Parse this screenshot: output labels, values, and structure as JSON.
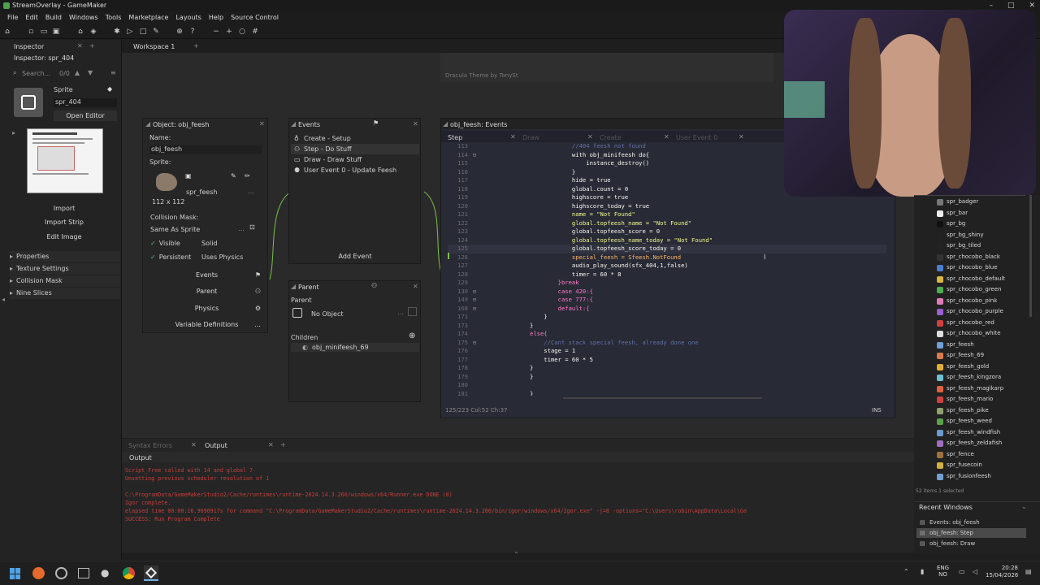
{
  "window": {
    "title": "StreamOverlay - GameMaker",
    "controls": [
      "–",
      "□",
      "✕"
    ]
  },
  "menu": [
    "File",
    "Edit",
    "Build",
    "Windows",
    "Tools",
    "Marketplace",
    "Layouts",
    "Help",
    "Source Control"
  ],
  "inspector": {
    "tab": "Inspector",
    "title": "Inspector: spr_404",
    "search_placeholder": "Search...",
    "counter": "0/0",
    "section": "Sprite",
    "sprite_name": "spr_404",
    "open_editor": "Open Editor",
    "buttons": [
      "Import",
      "Import Strip",
      "Edit Image"
    ],
    "sections": [
      "Properties",
      "Texture Settings",
      "Collision Mask",
      "Nine Slices"
    ]
  },
  "workspace": {
    "tab": "Workspace 1",
    "theme_note": "Dracula Theme by TonySt"
  },
  "object": {
    "title": "Object: obj_feesh",
    "name_label": "Name:",
    "name": "obj_feesh",
    "sprite_label": "Sprite:",
    "sprite": "spr_feesh",
    "sprite_size": "112 x 112",
    "collision_label": "Collision Mask:",
    "collision_value": "Same As Sprite",
    "visible": "Visible",
    "solid": "Solid",
    "persistent": "Persistent",
    "uses_physics": "Uses Physics",
    "buttons": [
      "Events",
      "Parent",
      "Physics",
      "Variable Definitions"
    ]
  },
  "events": {
    "title": "Events",
    "items": [
      "Create - Setup",
      "Step - Do Stuff",
      "Draw - Draw Stuff",
      "User Event 0 - Update Feesh"
    ],
    "add": "Add Event"
  },
  "parent": {
    "title": "Parent",
    "label": "Parent",
    "value": "No Object",
    "children_label": "Children",
    "child": "obj_minifeesh_69"
  },
  "editor": {
    "title": "obj_feesh: Events",
    "tabs": [
      "Step",
      "Draw",
      "Create",
      "User Event 0"
    ],
    "status": "125/223 Col:52 Ch:37",
    "mode": "INS",
    "lines": [
      {
        "n": "113",
        "t": "            //404 feesh not found",
        "c": "#6272a4"
      },
      {
        "n": "114",
        "t": "            with obj_minifeesh do{",
        "c": "#f8f8f2"
      },
      {
        "n": "115",
        "t": "                instance_destroy()",
        "c": "#f8f8f2"
      },
      {
        "n": "116",
        "t": "            }",
        "c": "#f8f8f2"
      },
      {
        "n": "117",
        "t": "            hide = true",
        "c": "#f8f8f2"
      },
      {
        "n": "118",
        "t": "            global.count = 0",
        "c": "#f8f8f2"
      },
      {
        "n": "119",
        "t": "            highscore = true",
        "c": "#f8f8f2"
      },
      {
        "n": "120",
        "t": "            highscore_today = true",
        "c": "#f8f8f2"
      },
      {
        "n": "121",
        "t": "            name = \"Not Found\"",
        "c": "#f1fa8c"
      },
      {
        "n": "122",
        "t": "            global.topfeesh_name = \"Not Found\"",
        "c": "#f1fa8c"
      },
      {
        "n": "123",
        "t": "            global.topfeesh_score = 0",
        "c": "#f8f8f2"
      },
      {
        "n": "124",
        "t": "            global.topfeesh_name_today = \"Not Found\"",
        "c": "#f1fa8c"
      },
      {
        "n": "125",
        "t": "            global.topfeesh_score_today = 0",
        "c": "#f8f8f2"
      },
      {
        "n": "126",
        "t": "            special_feesh = Sfeesh.NotFound",
        "c": "#ffb86c"
      },
      {
        "n": "127",
        "t": "            audio_play_sound(sfx_404,1,false)",
        "c": "#f8f8f2"
      },
      {
        "n": "128",
        "t": "            timer = 60 * 8",
        "c": "#f8f8f2"
      },
      {
        "n": "129",
        "t": "        }break",
        "c": "#ff79c6"
      },
      {
        "n": "130",
        "t": "        case 420:{",
        "c": "#ff79c6"
      },
      {
        "n": "149",
        "t": "        case 777:{",
        "c": "#ff79c6"
      },
      {
        "n": "168",
        "t": "        default:{",
        "c": "#ff79c6"
      },
      {
        "n": "171",
        "t": "    }",
        "c": "#f8f8f2"
      },
      {
        "n": "173",
        "t": "}",
        "c": "#f8f8f2"
      },
      {
        "n": "174",
        "t": "else{",
        "c": "#ff79c6"
      },
      {
        "n": "175",
        "t": "    //Cant stack special feesh, already done one",
        "c": "#6272a4"
      },
      {
        "n": "176",
        "t": "    stage = 1",
        "c": "#f8f8f2"
      },
      {
        "n": "177",
        "t": "    timer = 60 * 5",
        "c": "#f8f8f2"
      },
      {
        "n": "178",
        "t": "}",
        "c": "#f8f8f2"
      },
      {
        "n": "179",
        "t": "}",
        "c": "#f8f8f2"
      },
      {
        "n": "180",
        "t": "",
        "c": "#f8f8f2"
      },
      {
        "n": "181",
        "t": "}",
        "c": "#f8f8f2"
      },
      {
        "n": "182",
        "t": "",
        "c": "#f8f8f2"
      }
    ]
  },
  "output": {
    "tabs": [
      "Syntax Errors",
      "Output"
    ],
    "title": "Output",
    "lines": [
      {
        "t": "Script_Free called with 14 and global 7",
        "c": "#c43e3e"
      },
      {
        "t": "Unsetting previous scheduler resolution of 1",
        "c": "#c43e3e"
      },
      {
        "t": "",
        "c": "#c43e3e"
      },
      {
        "t": "C:\\ProgramData/GameMakerStudio2/Cache/runtimes\\runtime-2024.14.3.260/windows/x64/Runner.exe DONE (0)",
        "c": "#c43e3e"
      },
      {
        "t": "Igor complete.",
        "c": "#c43e3e"
      },
      {
        "t": "elapsed time 00:00:16.9696917s for command \"C:\\ProgramData/GameMakerStudio2/Cache/runtimes\\runtime-2024.14.3.260/bin/igor/windows/x64/Igor.exe\" -j=8 -options=\"C:\\Users\\robin\\AppData\\Local\\Ga",
        "c": "#c43e3e"
      },
      {
        "t": "SUCCESS: Run Program Complete",
        "c": "#c43e3e"
      }
    ]
  },
  "assets": {
    "items": [
      {
        "name": "spr_badger",
        "color": "#777"
      },
      {
        "name": "spr_bar",
        "color": "#eee"
      },
      {
        "name": "spr_bg",
        "color": "#111"
      },
      {
        "name": "spr_bg_shiny",
        "color": "#222"
      },
      {
        "name": "spr_bg_tiled",
        "color": "#222"
      },
      {
        "name": "spr_chocobo_black",
        "color": "#333"
      },
      {
        "name": "spr_chocobo_blue",
        "color": "#4a7fd0"
      },
      {
        "name": "spr_chocobo_default",
        "color": "#d8b642"
      },
      {
        "name": "spr_chocobo_green",
        "color": "#4caf50"
      },
      {
        "name": "spr_chocobo_pink",
        "color": "#e07bb8"
      },
      {
        "name": "spr_chocobo_purple",
        "color": "#9a5fd0"
      },
      {
        "name": "spr_chocobo_red",
        "color": "#d04040"
      },
      {
        "name": "spr_chocobo_white",
        "color": "#ddd"
      },
      {
        "name": "spr_feesh",
        "color": "#6fa0d8"
      },
      {
        "name": "spr_feesh_69",
        "color": "#d87a4a"
      },
      {
        "name": "spr_feesh_gold",
        "color": "#e0b030"
      },
      {
        "name": "spr_feesh_kingzora",
        "color": "#6fc0d0"
      },
      {
        "name": "spr_feesh_magikarp",
        "color": "#e06040"
      },
      {
        "name": "spr_feesh_mario",
        "color": "#d04040"
      },
      {
        "name": "spr_feesh_pike",
        "color": "#8fa070"
      },
      {
        "name": "spr_feesh_weed",
        "color": "#5ca04a"
      },
      {
        "name": "spr_feesh_windfish",
        "color": "#6a9ad0"
      },
      {
        "name": "spr_feesh_zeldafish",
        "color": "#a070c0"
      },
      {
        "name": "spr_fence",
        "color": "#a07040"
      },
      {
        "name": "spr_fusecoin",
        "color": "#d0b040"
      },
      {
        "name": "spr_fusionfeesh",
        "color": "#70a0d0"
      }
    ],
    "footer": "52 items 1 selected",
    "recent_title": "Recent Windows",
    "recent": [
      "Events: obj_feesh",
      "obj_feesh: Step",
      "obj_feesh: Draw"
    ]
  },
  "taskbar": {
    "lang": "ENG",
    "region": "NO",
    "time": "20:28",
    "date": "15/04/2026"
  }
}
